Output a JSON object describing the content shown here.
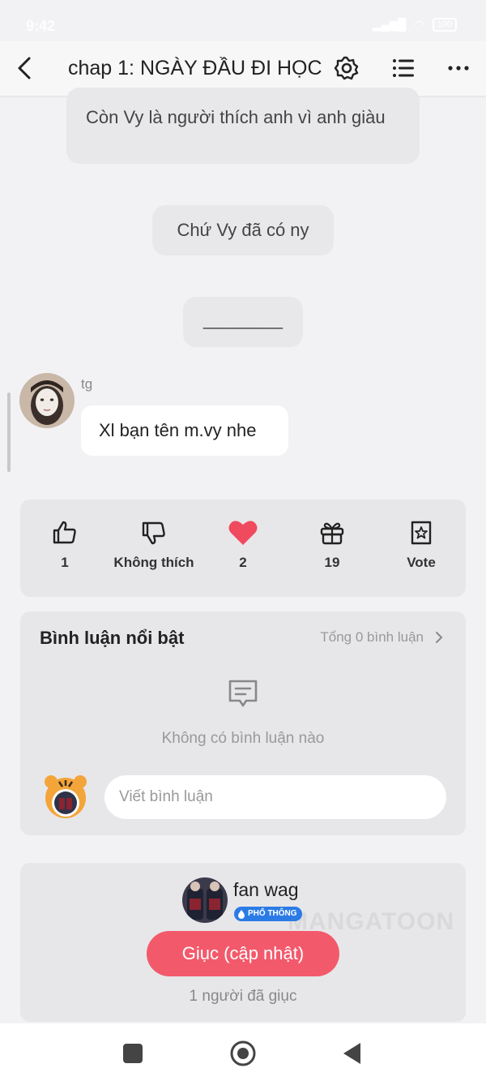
{
  "status_bar": {
    "time": "9:42",
    "battery": "100"
  },
  "header": {
    "title": "chap 1: NGÀY ĐẦU ĐI HỌC"
  },
  "story": {
    "bubbles": [
      "Còn Vy là người thích anh vì anh giàu",
      "Chứ Vy đã có ny",
      "________"
    ],
    "author_name": "tg",
    "author_message": "Xl bạn tên m.vy nhe"
  },
  "reactions": [
    {
      "icon": "thumbs-up-icon",
      "label": "1"
    },
    {
      "icon": "thumbs-down-icon",
      "label": "Không thích"
    },
    {
      "icon": "heart-icon",
      "label": "2"
    },
    {
      "icon": "gift-icon",
      "label": "19"
    },
    {
      "icon": "vote-icon",
      "label": "Vote"
    }
  ],
  "comments": {
    "title": "Bình luận nổi bật",
    "total": "Tổng 0 bình luận",
    "empty_text": "Không có bình luận nào",
    "input_placeholder": "Viết bình luận"
  },
  "author_card": {
    "name": "fan wag",
    "badge": "PHỔ THÔNG",
    "watermark": "MANGATOON",
    "urge_button": "Giục (cập nhật)",
    "urge_count": "1 người đã giục"
  },
  "colors": {
    "accent": "#f25a6c",
    "heart": "#f04a5e",
    "badge": "#2b7be6"
  }
}
